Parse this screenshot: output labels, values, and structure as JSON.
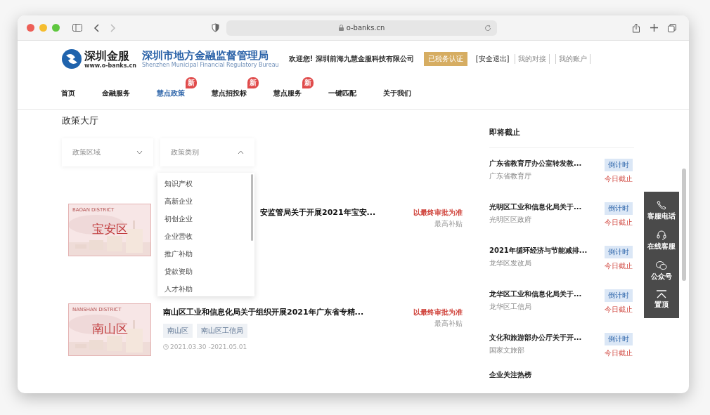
{
  "browser": {
    "url": "o-banks.cn"
  },
  "header": {
    "brand": "深圳金服",
    "brand_url": "www.o-banks.cn",
    "bureau": "深圳市地方金融监督管理局",
    "bureau_en": "Shenzhen Municipal Financial Regulatory Bureau",
    "welcome": "欢迎您!  深圳前海九慧金服科技有限公司",
    "verify_button": "已税务认证",
    "logout": "[安全退出]",
    "links": [
      "我的对接",
      "我的账户"
    ]
  },
  "nav": [
    {
      "label": "首页",
      "selected": false
    },
    {
      "label": "金融服务",
      "selected": false
    },
    {
      "label": "慧点政策",
      "selected": true,
      "badge": "新"
    },
    {
      "label": "慧点招投标",
      "selected": false,
      "badge": "新"
    },
    {
      "label": "慧点服务",
      "selected": false,
      "badge": "新"
    },
    {
      "label": "一键匹配",
      "selected": false
    },
    {
      "label": "关于我们",
      "selected": false
    }
  ],
  "page_title": "政策大厅",
  "filters": [
    {
      "label": "政策区域",
      "expanded": false
    },
    {
      "label": "政策类别",
      "expanded": true,
      "options": [
        "知识产权",
        "高新企业",
        "初创企业",
        "企业营收",
        "推广补助",
        "贷款资助",
        "人才补助"
      ]
    }
  ],
  "policies": [
    {
      "district_en": "BAOAN DISTRICT",
      "district": "宝安区",
      "title": "安监管局关于开展2021年宝安...",
      "partly_hidden": true,
      "amount": "以最终审批为准",
      "amount_label": "最高补贴"
    },
    {
      "district_en": "NANSHAN DISTRICT",
      "district": "南山区",
      "title": "南山区工业和信息化局关于组织开展2021年广东省专精...",
      "partly_hidden": false,
      "tags": [
        "南山区",
        "南山区工信局"
      ],
      "date": "2021.03.30 -2021.05.01",
      "amount": "以最终审批为准",
      "amount_label": "最高补贴"
    }
  ],
  "deadline": {
    "title": "即将截止",
    "items": [
      {
        "title": "广东省教育厅办公室转发教...",
        "org": "广东省教育厅",
        "badge": "倒计时",
        "status": "今日截止"
      },
      {
        "title": "光明区工业和信息化局关于...",
        "org": "光明区区政府",
        "badge": "倒计时",
        "status": "今日截止"
      },
      {
        "title": "2021年循环经济与节能减排...",
        "org": "龙华区发改局",
        "badge": "倒计时",
        "status": "今日截止"
      },
      {
        "title": "龙华区工业和信息化局关于...",
        "org": "龙华区工信局",
        "badge": "倒计时",
        "status": "今日截止"
      },
      {
        "title": "文化和旅游部办公厅关于开...",
        "org": "国家文旅部",
        "badge": "倒计时",
        "status": "今日截止"
      }
    ]
  },
  "hot_title": "企业关注热榜",
  "float_panel": [
    {
      "kind": "phone",
      "label": "客服电话"
    },
    {
      "kind": "headset",
      "label": "在线客服"
    },
    {
      "kind": "wechat",
      "label": "公众号"
    },
    {
      "kind": "top",
      "label": "置顶"
    }
  ]
}
